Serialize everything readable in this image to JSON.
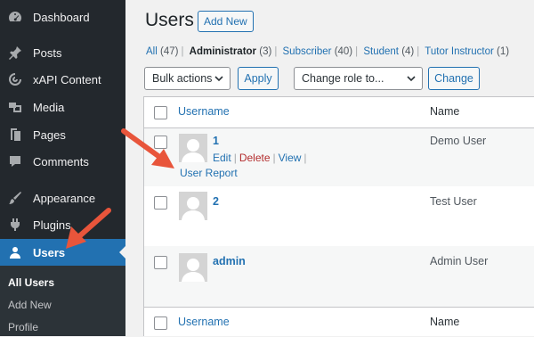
{
  "sidebar": {
    "items": [
      {
        "label": "Dashboard",
        "icon": "dashboard-icon"
      },
      {
        "label": "Posts",
        "icon": "pushpin-icon"
      },
      {
        "label": "xAPI Content",
        "icon": "xapi-icon"
      },
      {
        "label": "Media",
        "icon": "media-icon"
      },
      {
        "label": "Pages",
        "icon": "pages-icon"
      },
      {
        "label": "Comments",
        "icon": "comment-icon"
      },
      {
        "label": "Appearance",
        "icon": "brush-icon"
      },
      {
        "label": "Plugins",
        "icon": "plug-icon"
      },
      {
        "label": "Users",
        "icon": "users-icon"
      }
    ],
    "submenu": [
      "All Users",
      "Add New",
      "Profile"
    ]
  },
  "main": {
    "title": "Users",
    "add_new": "Add New",
    "views": {
      "all": "All",
      "all_count": "(47)",
      "administrator": "Administrator",
      "administrator_count": "(3)",
      "subscriber": "Subscriber",
      "subscriber_count": "(40)",
      "student": "Student",
      "student_count": "(4)",
      "tutor": "Tutor Instructor",
      "tutor_count": "(1)"
    },
    "bulk_actions": "Bulk actions",
    "apply": "Apply",
    "change_role": "Change role to...",
    "change": "Change",
    "table": {
      "col_username": "Username",
      "col_name": "Name",
      "rows": [
        {
          "username": "1",
          "name": "Demo User"
        },
        {
          "username": "2",
          "name": "Test User"
        },
        {
          "username": "admin",
          "name": "Admin User"
        }
      ],
      "row_actions": {
        "edit": "Edit",
        "delete": "Delete",
        "view": "View",
        "user_report": "User Report"
      }
    }
  },
  "colors": {
    "sidebar_bg": "#23282d",
    "accent": "#2271b1",
    "arrow": "#e8553b",
    "delete": "#b32d2e"
  }
}
